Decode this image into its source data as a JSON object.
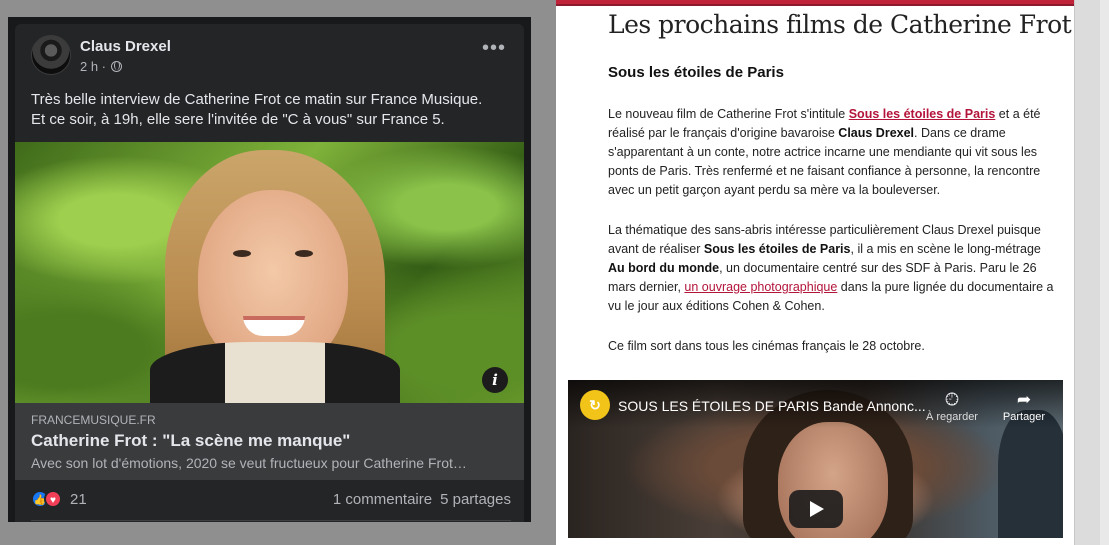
{
  "facebook_post": {
    "author": "Claus Drexel",
    "time": "2 h ·",
    "more": "•••",
    "text": [
      "Très belle interview de Catherine Frot ce matin sur France Musique.",
      "Et ce soir, à 19h, elle sere l'invitée de \"C à vous\" sur France 5."
    ],
    "info_button": "i",
    "link": {
      "domain": "FRANCEMUSIQUE.FR",
      "title": "Catherine Frot : \"La scène me manque\"",
      "description": "Avec son lot d'émotions, 2020 se veut fructueux pour Catherine Frot…"
    },
    "reactions": {
      "count": "21",
      "icons": [
        "like-reaction",
        "love-reaction"
      ]
    },
    "comments": "1 commentaire",
    "shares": "5 partages"
  },
  "article": {
    "heading": "Les prochains films de Catherine Frot",
    "subheading": "Sous les étoiles de Paris",
    "p1": {
      "t1": "Le nouveau film de Catherine Frot s'intitule ",
      "link": "Sous les étoiles de Paris",
      "t2": " et a été réalisé par le français d'origine bavaroise ",
      "bold": "Claus Drexel",
      "t3": ". Dans ce drame s'apparentant à un conte, notre actrice incarne une mendiante qui vit sous les ponts de Paris. Très renfermé et ne faisant confiance à personne, la rencontre avec un petit garçon ayant perdu sa mère va la bouleverser."
    },
    "p2": {
      "t1": "La thématique des sans-abris intéresse particulièrement Claus Drexel puisque avant de réaliser ",
      "bold1": "Sous les étoiles de Paris",
      "t2": ", il a mis en scène le long-métrage ",
      "bold2": "Au bord du monde",
      "t3": ", un documentaire centré sur des SDF à Paris. Paru le 26 mars dernier, ",
      "link": "un ouvrage photographique",
      "t4": " dans la pure lignée du documentaire a vu le jour aux éditions Cohen & Cohen."
    },
    "p3": "Ce film sort dans tous les cinémas français le 28 octobre.",
    "video": {
      "title": "SOUS LES ÉTOILES DE PARIS Bande Annonc...",
      "watch_later": "À regarder",
      "share": "Partager",
      "channel_logo": "↻"
    }
  },
  "colors": {
    "fb_background": "#18191a",
    "fb_card": "#242526",
    "article_accent": "#c0223a",
    "link_color": "#b3143a"
  }
}
